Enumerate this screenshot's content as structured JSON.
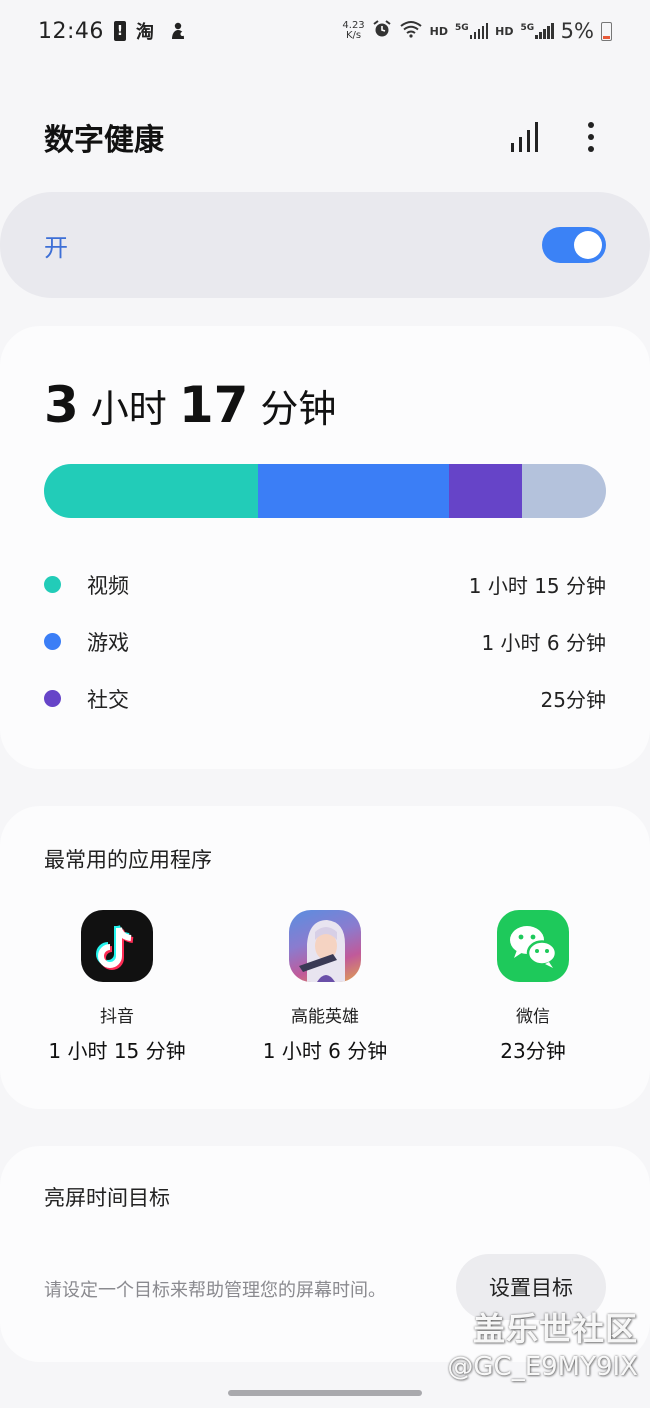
{
  "status_bar": {
    "time": "12:46",
    "net_speed_value": "4.23",
    "net_speed_unit": "K/s",
    "hd1": "HD",
    "hd2": "HD",
    "sim1": "5G",
    "sim2": "5G",
    "battery_pct": "5%",
    "icons": [
      "battery-alert-icon",
      "taobao-icon",
      "app-notification-icon",
      "alarm-icon",
      "wifi-icon",
      "signal-icon",
      "battery-icon"
    ]
  },
  "header": {
    "title": "数字健康"
  },
  "master_toggle": {
    "label": "开",
    "on": true
  },
  "usage": {
    "hours": "3",
    "hours_unit": "小时",
    "minutes": "17",
    "minutes_unit": "分钟",
    "segments": [
      {
        "name": "视频",
        "fraction": 0.38,
        "color": "#22ccb8"
      },
      {
        "name": "游戏",
        "fraction": 0.34,
        "color": "#3b7ef6"
      },
      {
        "name": "社交",
        "fraction": 0.13,
        "color": "#6644c8"
      },
      {
        "name": "other",
        "fraction": 0.15,
        "color": "#b4c2dc"
      }
    ],
    "legend": [
      {
        "label": "视频",
        "value": "1 小时 15 分钟",
        "color": "#22ccb8"
      },
      {
        "label": "游戏",
        "value": "1 小时 6 分钟",
        "color": "#3b7ef6"
      },
      {
        "label": "社交",
        "value": "25分钟",
        "color": "#6644c8"
      }
    ]
  },
  "most_used": {
    "title": "最常用的应用程序",
    "apps": [
      {
        "name": "抖音",
        "time": "1 小时 15 分钟",
        "icon": "douyin-icon"
      },
      {
        "name": "高能英雄",
        "time": "1 小时 6 分钟",
        "icon": "game-hero-icon"
      },
      {
        "name": "微信",
        "time": "23分钟",
        "icon": "wechat-icon"
      }
    ]
  },
  "goal": {
    "title": "亮屏时间目标",
    "description": "请设定一个目标来帮助管理您的屏幕时间。",
    "button_label": "设置目标"
  },
  "watermark": {
    "line1": "盖乐世社区",
    "line2": "@GC_E9MY9IX"
  }
}
